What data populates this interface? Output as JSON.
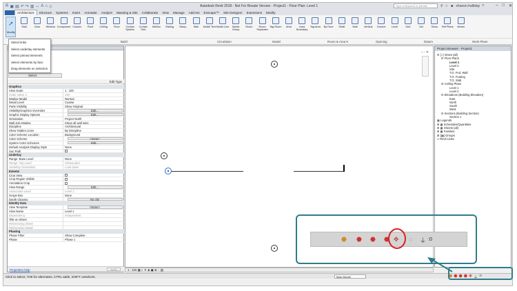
{
  "titlebar": {
    "title": "Autodesk Revit 2018 -  Not For Resale Version  -   Project1 - Floor Plan: Level 1",
    "search_placeholder": "Type a keyword or phrase",
    "user": "shanon.halliday"
  },
  "ribbon_tabs": [
    "Architecture",
    "Structure",
    "Systems",
    "Insert",
    "Annotate",
    "Analyze",
    "Massing & Site",
    "Collaborate",
    "View",
    "Manage",
    "Add-Ins",
    "Enscape™",
    "Site Designer",
    "Extensions",
    "Modify"
  ],
  "ribbon": {
    "modify_label": "Modify",
    "tools": [
      "Wall",
      "Door",
      "Window",
      "Component",
      "Column",
      "Roof",
      "Ceiling",
      "Floor",
      "Curtain System",
      "Curtain Grid",
      "Mullion",
      "Railing",
      "Ramp",
      "Stair",
      "Model Text",
      "Model Line",
      "Model Group",
      "Room",
      "Room Separator",
      "Tag Room",
      "Area",
      "Area Boundary",
      "Tag Area",
      "By Face",
      "Shaft",
      "Wall",
      "Vertical",
      "Dormer",
      "Level",
      "Grid",
      "Set",
      "Show",
      "Ref Plane",
      "Viewer"
    ],
    "panels": [
      "Build",
      "Circulation",
      "Model",
      "Room & Area ▾",
      "Opening",
      "Datum",
      "Work Plane"
    ]
  },
  "select_menu": {
    "items": [
      "Select links",
      "Select underlay elements",
      "Select pinned elements",
      "Select elements by face",
      "Drag elements on selection"
    ],
    "label": "Select",
    "edit_type": "Edit Type"
  },
  "properties": {
    "rows": [
      {
        "k": "Graphics",
        "v": "",
        "t": "grp"
      },
      {
        "k": "View Scale",
        "v": "1 : 100"
      },
      {
        "k": "Scale Value   1:",
        "v": "100",
        "t": "grey"
      },
      {
        "k": "Display Model",
        "v": "Normal"
      },
      {
        "k": "Detail Level",
        "v": "Coarse"
      },
      {
        "k": "Parts Visibility",
        "v": "Show Original"
      },
      {
        "k": "Visibility/Graphics Overrides",
        "v": "Edit...",
        "t": "btn"
      },
      {
        "k": "Graphic Display Options",
        "v": "Edit...",
        "t": "btn"
      },
      {
        "k": "Orientation",
        "v": "Project North"
      },
      {
        "k": "Wall Join Display",
        "v": "Clean all wall joins"
      },
      {
        "k": "Discipline",
        "v": "Architectural"
      },
      {
        "k": "Show Hidden Lines",
        "v": "By Discipline"
      },
      {
        "k": "Color Scheme Location",
        "v": "Background"
      },
      {
        "k": "Color Scheme",
        "v": "<none>",
        "t": "btn"
      },
      {
        "k": "System Color Schemes",
        "v": "Edit...",
        "t": "btn"
      },
      {
        "k": "Default Analysis Display Style",
        "v": "None"
      },
      {
        "k": "Sun Path",
        "v": "",
        "t": "chk"
      },
      {
        "k": "Underlay",
        "v": "",
        "t": "grp"
      },
      {
        "k": "Range: Base Level",
        "v": "None"
      },
      {
        "k": "Range: Top Level",
        "v": "Unbounded",
        "t": "grey"
      },
      {
        "k": "Underlay Orientation",
        "v": "Look down",
        "t": "grey"
      },
      {
        "k": "Extents",
        "v": "",
        "t": "grp"
      },
      {
        "k": "Crop View",
        "v": "",
        "t": "chk"
      },
      {
        "k": "Crop Region Visible",
        "v": "",
        "t": "chk"
      },
      {
        "k": "Annotation Crop",
        "v": "",
        "t": "chk"
      },
      {
        "k": "View Range",
        "v": "Edit...",
        "t": "btn"
      },
      {
        "k": "Associated Level",
        "v": "Level 1",
        "t": "grey"
      },
      {
        "k": "Scope Box",
        "v": "None"
      },
      {
        "k": "Depth Clipping",
        "v": "No clip",
        "t": "btn"
      },
      {
        "k": "Identity Data",
        "v": "",
        "t": "grp"
      },
      {
        "k": "View Template",
        "v": "<None>",
        "t": "btn"
      },
      {
        "k": "View Name",
        "v": "Level 1"
      },
      {
        "k": "Dependency",
        "v": "Independent",
        "t": "grey"
      },
      {
        "k": "Title on Sheet",
        "v": ""
      },
      {
        "k": "Referencing Sheet",
        "v": "",
        "t": "grey"
      },
      {
        "k": "Referencing Detail",
        "v": "",
        "t": "grey"
      },
      {
        "k": "Phasing",
        "v": "",
        "t": "grp"
      },
      {
        "k": "Phase Filter",
        "v": "Show Complete"
      },
      {
        "k": "Phase",
        "v": "Phase 1"
      }
    ],
    "help_link": "Properties help",
    "apply_label": "Apply"
  },
  "viewbar": {
    "scale": "1 : 100"
  },
  "browser": {
    "title": "Project Browser - Project1",
    "tree": [
      {
        "t": "⊟ [○] Views (all)",
        "i": 0
      },
      {
        "t": "⊟ Floor Plans",
        "i": 1
      },
      {
        "t": "Level 1",
        "i": 3,
        "b": true
      },
      {
        "t": "Level 2",
        "i": 3
      },
      {
        "t": "Site",
        "i": 3
      },
      {
        "t": "T.O. Fnd. Wall",
        "i": 3
      },
      {
        "t": "T.O. Footing",
        "i": 3
      },
      {
        "t": "T.O. Slab",
        "i": 3
      },
      {
        "t": "⊟ Ceiling Plans",
        "i": 1
      },
      {
        "t": "Level 1",
        "i": 3
      },
      {
        "t": "Level 2",
        "i": 3
      },
      {
        "t": "⊟ Elevations (Building Elevation)",
        "i": 1
      },
      {
        "t": "East",
        "i": 3
      },
      {
        "t": "North",
        "i": 3
      },
      {
        "t": "South",
        "i": 3
      },
      {
        "t": "West",
        "i": 3
      },
      {
        "t": "⊟ Sections (Building Section)",
        "i": 1
      },
      {
        "t": "Section 1",
        "i": 3
      },
      {
        "t": "▦ Legends",
        "i": 0
      },
      {
        "t": "⊞ ▦ Schedules/Quantities",
        "i": 0
      },
      {
        "t": "⊞ ▦ Sheets (all)",
        "i": 0
      },
      {
        "t": "⊞ ▦ Families",
        "i": 0
      },
      {
        "t": "⊞ [▦] Groups",
        "i": 0
      },
      {
        "t": "∞ Revit Links",
        "i": 0
      }
    ]
  },
  "statusbar": {
    "hint": "Click to select, TAB for alternates, CTRL adds, SHIFT unselects.",
    "model": "Main Model",
    "filter_count": ":0"
  },
  "callout": {
    "filter_count": ":0"
  },
  "colors": {
    "accent": "#2e7c8a",
    "highlight": "#d62020",
    "ribbon_blue": "#2b64a8"
  }
}
